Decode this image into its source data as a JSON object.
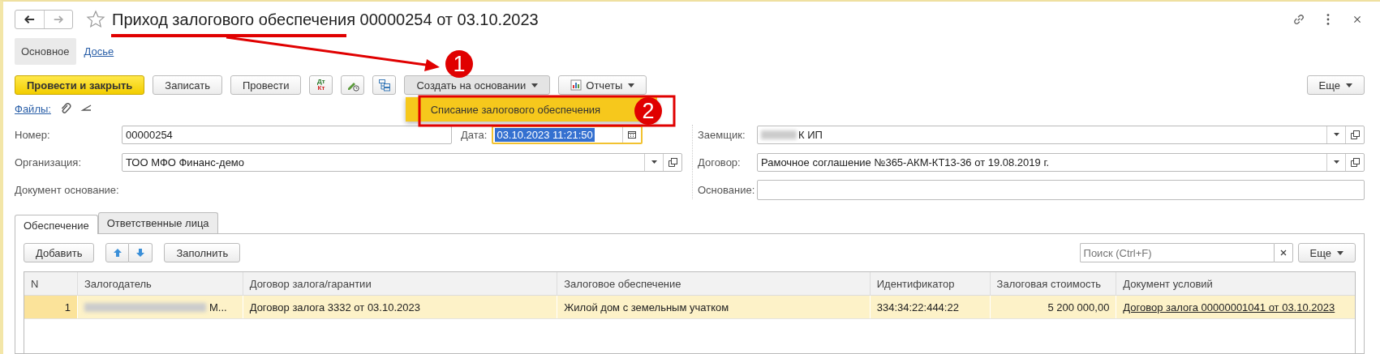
{
  "window": {
    "title": "Приход залогового обеспечения 00000254 от 03.10.2023",
    "favorite": false
  },
  "nav_tabs": [
    {
      "label": "Основное",
      "selected": true
    },
    {
      "label": "Досье",
      "selected": false
    }
  ],
  "toolbar": [
    {
      "kind": "primary",
      "label": "Провести и закрыть"
    },
    {
      "kind": "plain",
      "label": "Записать"
    },
    {
      "kind": "plain",
      "label": "Провести"
    },
    {
      "kind": "dtkt",
      "top": "Дт",
      "bottom": "Кт"
    },
    {
      "kind": "edit-history"
    },
    {
      "kind": "structure"
    },
    {
      "kind": "menu",
      "label": "Создать на основании",
      "expanded": true
    },
    {
      "kind": "report-menu",
      "label": "Отчеты",
      "expanded": false
    }
  ],
  "more_button": {
    "label": "Еще"
  },
  "popup_menu": [
    {
      "label": "Списание залогового обеспечения",
      "selected": true
    }
  ],
  "files": {
    "label": "Файлы:"
  },
  "number": {
    "label": "Номер:",
    "value": "00000254"
  },
  "date": {
    "label": "Дата:",
    "value": "03.10.2023 11:21:50",
    "focused": true
  },
  "organization": {
    "label": "Организация:",
    "value": "ТОО МФО Финанс-демо"
  },
  "base_document": {
    "label": "Документ основание:"
  },
  "borrower": {
    "label": "Заемщик:",
    "value": "К ИП",
    "redacted": true
  },
  "contract": {
    "label": "Договор:",
    "value": "Рамочное соглашение №365-АКМ-КТ13-36 от 19.08.2019 г."
  },
  "basis": {
    "label": "Основание:"
  },
  "detail_tabs": [
    {
      "label": "Обеспечение",
      "selected": true
    },
    {
      "label": "Ответственные лица",
      "selected": false
    }
  ],
  "table_toolbar": {
    "add": "Добавить",
    "fill": "Заполнить",
    "search_placeholder": "Поиск (Ctrl+F)",
    "more": "Еще"
  },
  "table": {
    "columns": [
      {
        "label": "N"
      },
      {
        "label": "Залогодатель"
      },
      {
        "label": "Договор залога/гарантии"
      },
      {
        "label": "Залоговое обеспечение"
      },
      {
        "label": "Идентификатор"
      },
      {
        "label": "Залоговая стоимость"
      },
      {
        "label": "Документ условий"
      }
    ],
    "rows": [
      {
        "selected": true,
        "cells": [
          {
            "text": "1"
          },
          {
            "text": "М...",
            "redacted": true
          },
          {
            "text": "Договор залога 3332 от 03.10.2023"
          },
          {
            "text": "Жилой дом с земельным учатком"
          },
          {
            "text": "334:34:22:444:22"
          },
          {
            "text": "5 200 000,00"
          },
          {
            "text": "Договор залога 00000001041 от 03.10.2023",
            "link": true
          }
        ]
      }
    ]
  },
  "annotations": [
    {
      "label": "1"
    },
    {
      "label": "2"
    }
  ]
}
